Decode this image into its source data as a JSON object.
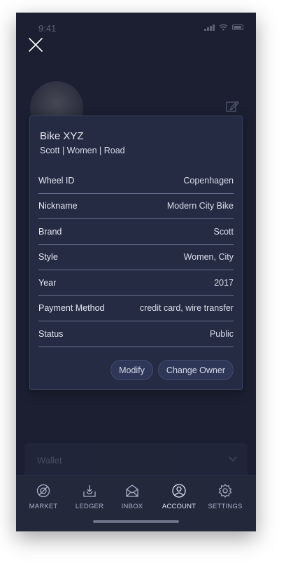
{
  "status_bar": {
    "time": "9:41"
  },
  "card": {
    "title": "Bike XYZ",
    "subtitle": "Scott | Women | Road",
    "rows": [
      {
        "label": "Wheel ID",
        "value": "Copenhagen"
      },
      {
        "label": "Nickname",
        "value": "Modern City Bike"
      },
      {
        "label": "Brand",
        "value": "Scott"
      },
      {
        "label": "Style",
        "value": "Women, City"
      },
      {
        "label": "Year",
        "value": "2017"
      },
      {
        "label": "Payment Method",
        "value": "credit card, wire transfer"
      },
      {
        "label": "Status",
        "value": "Public"
      }
    ],
    "modify_label": "Modify",
    "change_owner_label": "Change Owner"
  },
  "wallet": {
    "label": "Wallet"
  },
  "tabbar": {
    "tabs": [
      {
        "label": "MARKET",
        "icon": "market-icon"
      },
      {
        "label": "LEDGER",
        "icon": "ledger-icon"
      },
      {
        "label": "INBOX",
        "icon": "inbox-icon"
      },
      {
        "label": "ACCOUNT",
        "icon": "account-icon",
        "active": true
      },
      {
        "label": "SETTINGS",
        "icon": "settings-icon"
      }
    ]
  },
  "colors": {
    "background": "#1b1f31",
    "card": "#252b43",
    "button": "#2e3757",
    "tabbar": "#23283b"
  }
}
